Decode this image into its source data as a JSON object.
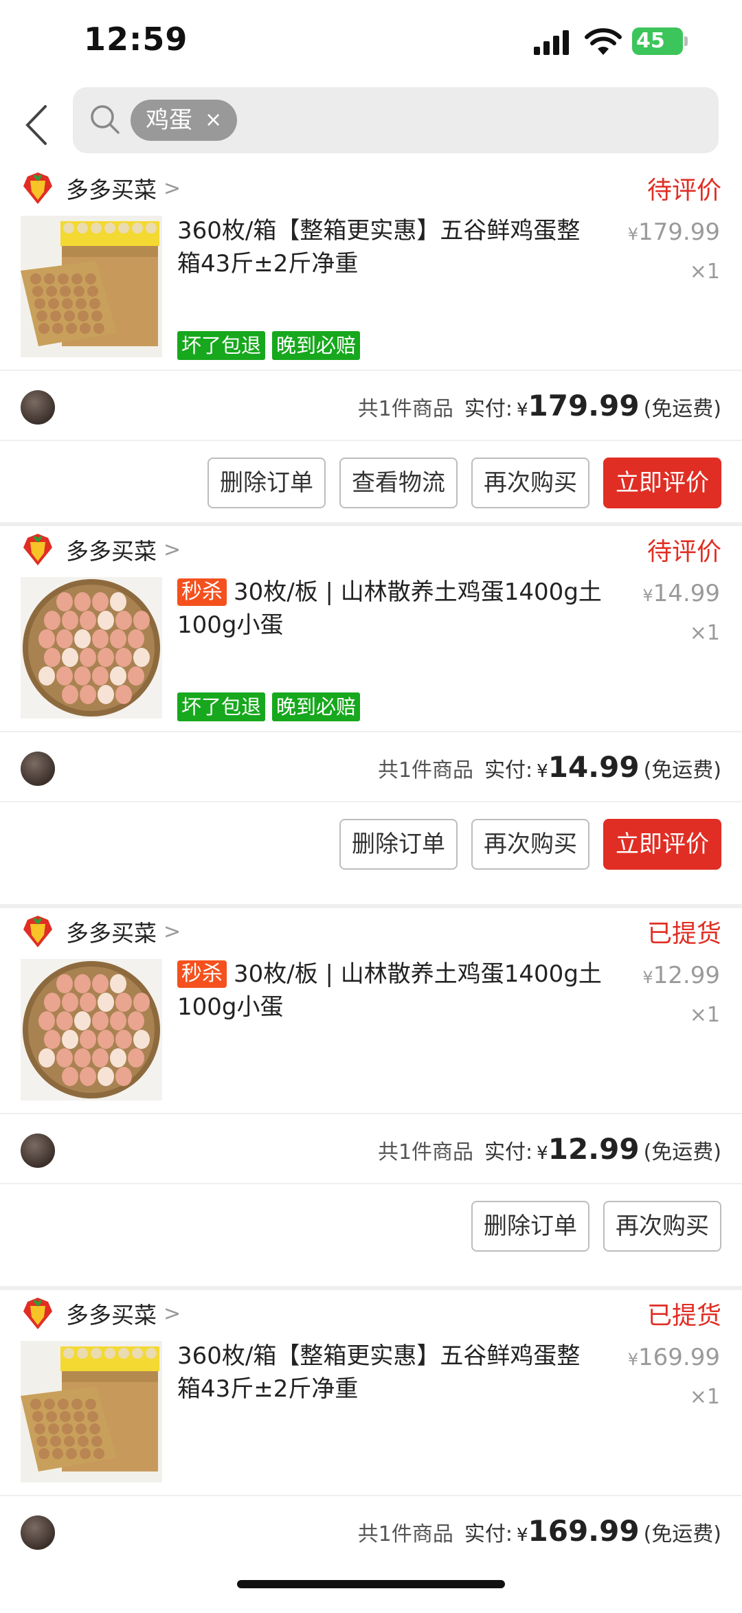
{
  "status_bar": {
    "time": "12:59",
    "battery": "45"
  },
  "search": {
    "chip_label": "鸡蛋",
    "chip_clear": "×"
  },
  "orders": [
    {
      "shop": "多多买菜",
      "status": "待评价",
      "title": "360枚/箱【整箱更实惠】五谷鲜鸡蛋整箱43斤±2斤净重",
      "badge": "",
      "unit_price": "179.99",
      "qty": "×1",
      "tags": [
        "坏了包退",
        "晚到必赔"
      ],
      "summary": {
        "count": "共1件商品",
        "paid_label": "实付:",
        "currency": "¥",
        "amount": "179.99",
        "shipping": "(免运费)"
      },
      "buttons": [
        "删除订单",
        "查看物流",
        "再次购买",
        "立即评价"
      ]
    },
    {
      "shop": "多多买菜",
      "status": "待评价",
      "title": "30枚/板 | 山林散养土鸡蛋1400g土100g小蛋",
      "badge": "秒杀",
      "unit_price": "14.99",
      "qty": "×1",
      "tags": [
        "坏了包退",
        "晚到必赔"
      ],
      "summary": {
        "count": "共1件商品",
        "paid_label": "实付:",
        "currency": "¥",
        "amount": "14.99",
        "shipping": "(免运费)"
      },
      "buttons": [
        "删除订单",
        "再次购买",
        "立即评价"
      ]
    },
    {
      "shop": "多多买菜",
      "status": "已提货",
      "title": "30枚/板 | 山林散养土鸡蛋1400g土100g小蛋",
      "badge": "秒杀",
      "unit_price": "12.99",
      "qty": "×1",
      "tags": [],
      "summary": {
        "count": "共1件商品",
        "paid_label": "实付:",
        "currency": "¥",
        "amount": "12.99",
        "shipping": "(免运费)"
      },
      "buttons": [
        "删除订单",
        "再次购买"
      ]
    },
    {
      "shop": "多多买菜",
      "status": "已提货",
      "title": "360枚/箱【整箱更实惠】五谷鲜鸡蛋整箱43斤±2斤净重",
      "badge": "",
      "unit_price": "169.99",
      "qty": "×1",
      "tags": [],
      "summary": {
        "count": "共1件商品",
        "paid_label": "实付:",
        "currency": "¥",
        "amount": "169.99",
        "shipping": "(免运费)"
      },
      "buttons": []
    }
  ],
  "colors": {
    "accent_red": "#e02e24",
    "tag_green": "#17a81d",
    "seckill_orange": "#f4511e"
  },
  "icons": [
    "back-icon",
    "search-icon",
    "shop-logo-icon",
    "chevron-right-icon"
  ]
}
